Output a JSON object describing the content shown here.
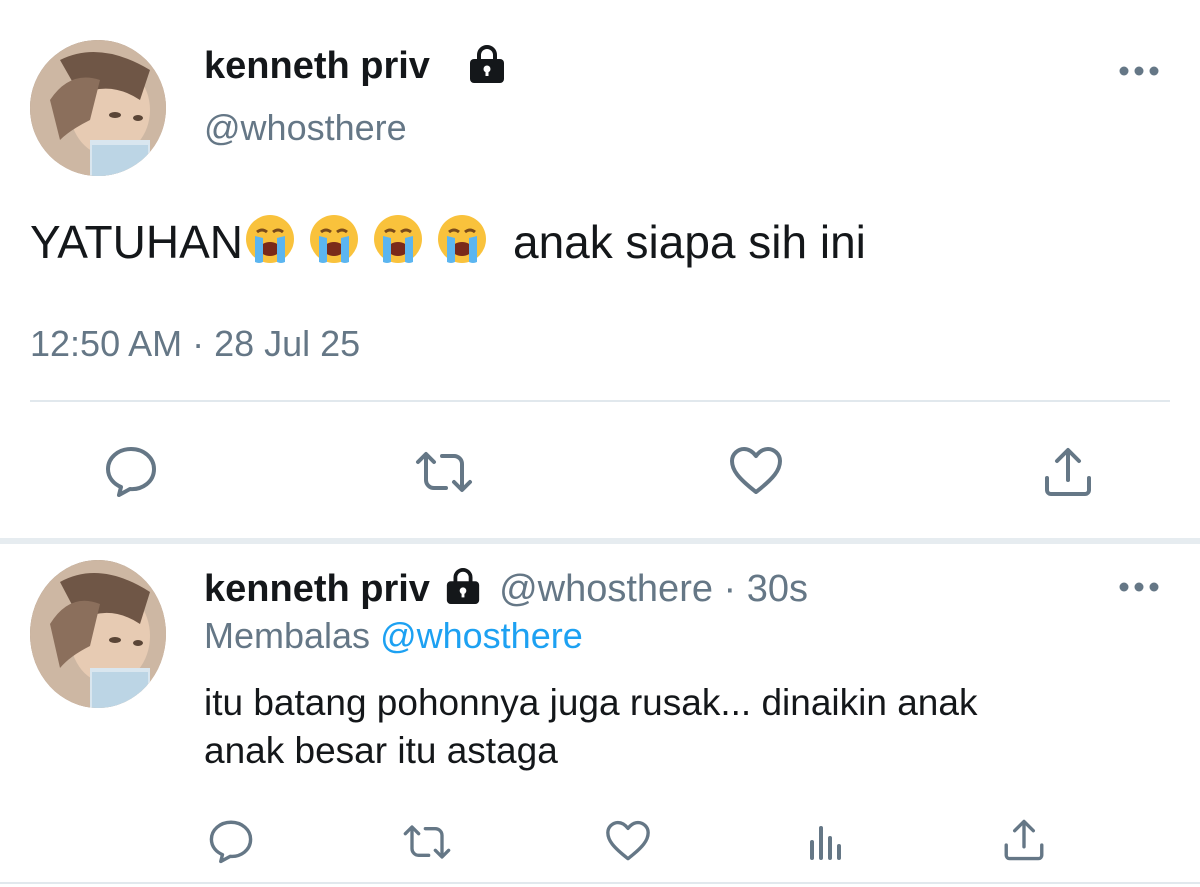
{
  "main_tweet": {
    "author_name": "kenneth priv",
    "handle": "@whosthere",
    "text_before_emoji": "YATUHAN",
    "emoji": [
      "loudly-crying-face",
      "loudly-crying-face",
      "loudly-crying-face",
      "loudly-crying-face"
    ],
    "text_after_emoji": "anak siapa sih ini",
    "timestamp": "12:50 AM · 28 Jul 25"
  },
  "reply_tweet": {
    "author_name": "kenneth priv",
    "handle": "@whosthere",
    "time_ago": "· 30s",
    "replying_prefix": "Membalas",
    "replying_to": "@whosthere",
    "text_line1": "itu batang pohonnya juga rusak... dinaikin anak",
    "text_line2": "anak besar itu astaga"
  },
  "icons": {
    "lock": "lock-icon",
    "more": "more-icon",
    "reply": "reply-icon",
    "retweet": "retweet-icon",
    "like": "heart-icon",
    "share": "share-icon",
    "analytics": "analytics-icon"
  },
  "colors": {
    "text": "#14171a",
    "secondary": "#657786",
    "link": "#1da1f2",
    "divider": "#e1e8ed"
  }
}
